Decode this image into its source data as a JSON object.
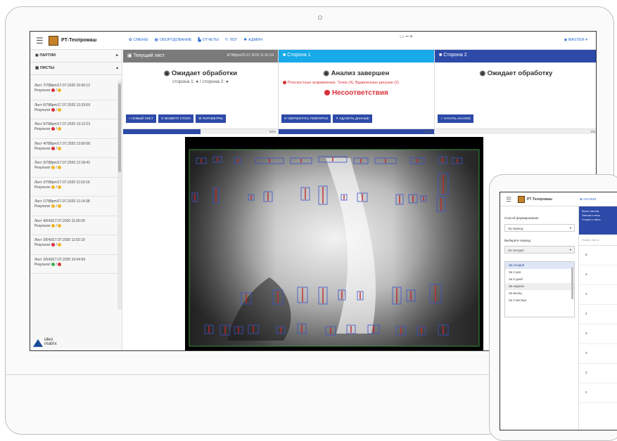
{
  "app": {
    "name": "РТ-Техпромаш",
    "user": "MASTER"
  },
  "nav": [
    {
      "icon": "✿",
      "label": "смены"
    },
    {
      "icon": "▦",
      "label": "оборудование"
    },
    {
      "icon": "▙",
      "label": "отчеты"
    },
    {
      "icon": "↻",
      "label": "лог"
    },
    {
      "icon": "✱",
      "label": "админ"
    }
  ],
  "sidebar": {
    "batches_label": "ПАРТИИ",
    "sheets_label": "ЛИСТЫ",
    "sheets": [
      {
        "title": "Лист 7/788pm/17.07.2020 15:00:12",
        "result_label": "Результат",
        "s1": "r",
        "s2": "y"
      },
      {
        "title": "Лист 6/788pm/17.07.2020 13:33:09",
        "result_label": "Результат",
        "s1": "r",
        "s2": "y"
      },
      {
        "title": "Лист 5/788pm/17.07.2020 13:12:23",
        "result_label": "Результат",
        "s1": "r",
        "s2": "y"
      },
      {
        "title": "Лист 4/788pm/17.07.2020 13:00:08",
        "result_label": "Результат",
        "s1": "r",
        "s2": "y"
      },
      {
        "title": "Лист 3/788pm/17.07.2020 12:18:42",
        "result_label": "Результат",
        "s1": "y",
        "s2": "y"
      },
      {
        "title": "Лист 2/788pm/17.07.2020 11:53:16",
        "result_label": "Результат",
        "s1": "y",
        "s2": "y"
      },
      {
        "title": "Лист 1/788pm/17.07.2020 11:14:38",
        "result_label": "Результат",
        "s1": "y",
        "s2": "y"
      },
      {
        "title": "Лист 4/543/17.07.2020 11:00:29",
        "result_label": "Результат",
        "s1": "y",
        "s2": "y"
      },
      {
        "title": "Лист 3/543/17.07.2020 11:02:19",
        "result_label": "Результат",
        "s1": "r",
        "s2": "y"
      },
      {
        "title": "Лист 2/543/17.07.2020 10:54:59",
        "result_label": "Результат",
        "s1": "g",
        "s2": "r"
      }
    ]
  },
  "brand": {
    "line1": "ideo",
    "line2": "matrix"
  },
  "panels": {
    "current": {
      "header": "Текущий лист",
      "timestamp": "8/788pm/20.07.2020 11:01:04",
      "status": "Ожидает обработки",
      "sub": "сторона 1: ● / сторона 2: ●",
      "buttons": [
        "+ новый лист",
        "⟳ возврат стола",
        "⚙ параметры"
      ],
      "progress": 0.5,
      "progress_label": "50%"
    },
    "side1": {
      "header": "Сторона 1",
      "status": "Анализ завершен",
      "defects": "Плоскостные искривления, Точки (4), Вдавленные рисунки (2)",
      "nonconformity": "Несоответствия",
      "buttons": [
        "⟳ обработать повторно",
        "✕ удалить данные"
      ],
      "progress": 1,
      "progress_label": "100%"
    },
    "side2": {
      "header": "Сторона 2",
      "status": "Ожидает обработку",
      "buttons": [
        "✓ начать анализ"
      ],
      "progress": 0,
      "progress_label": "0%"
    }
  },
  "colors": {
    "primary": "#2d4aa8",
    "panel_grey": "#7a7a7a",
    "panel_cyan": "#17a9e8",
    "error": "#d9303a",
    "warn": "#f0b526",
    "ok": "#3fae49"
  },
  "tablet": {
    "app_name": "РТ-Техпромаш",
    "analysis_label": "АНАЛИЗ",
    "method_label": "Способ формирования",
    "method_value": "За период",
    "period_label": "Выберите период",
    "period_value": "За сегодня",
    "options": [
      "За сегодня",
      "За 2 дня",
      "За 5 дней",
      "За неделю",
      "За месяц",
      "За 2 месяца"
    ],
    "summary_lines": [
      "Всего листов",
      "Листов с несо",
      "Сторон с несо"
    ],
    "table_header": "Номер листа",
    "rows": [
      "5",
      "3",
      "4",
      "4",
      "3",
      "3",
      "2",
      "2"
    ]
  }
}
